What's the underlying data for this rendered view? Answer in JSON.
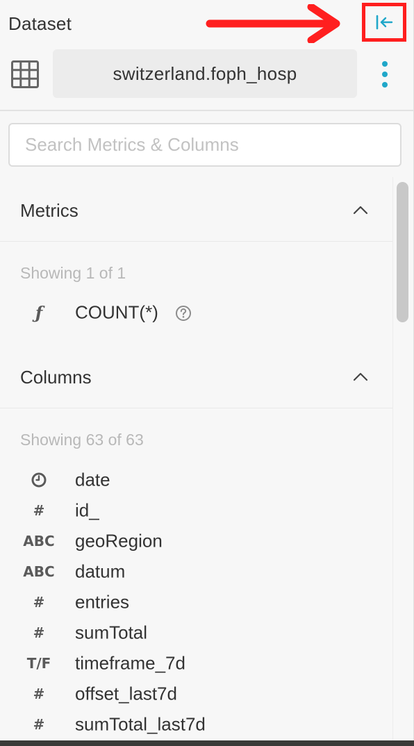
{
  "header": {
    "title": "Dataset",
    "collapse_icon": "collapse-left-arrow-icon"
  },
  "dataset": {
    "icon": "table-grid-icon",
    "name": "switzerland.foph_hosp",
    "more_icon": "more-vertical-icon"
  },
  "search": {
    "placeholder": "Search Metrics & Columns",
    "value": ""
  },
  "metrics": {
    "title": "Metrics",
    "showing": "Showing 1 of 1",
    "items": [
      {
        "type_icon": "ƒ",
        "name": "COUNT(*)",
        "help_icon": "question-circle-icon"
      }
    ]
  },
  "columns": {
    "title": "Columns",
    "showing": "Showing 63 of 63",
    "items": [
      {
        "type_icon": "clock-icon",
        "name": "date"
      },
      {
        "type_icon": "#",
        "name": "id_"
      },
      {
        "type_icon": "ABC",
        "name": "geoRegion"
      },
      {
        "type_icon": "ABC",
        "name": "datum"
      },
      {
        "type_icon": "#",
        "name": "entries"
      },
      {
        "type_icon": "#",
        "name": "sumTotal"
      },
      {
        "type_icon": "T/F",
        "name": "timeframe_7d"
      },
      {
        "type_icon": "#",
        "name": "offset_last7d"
      },
      {
        "type_icon": "#",
        "name": "sumTotal_last7d"
      }
    ]
  },
  "colors": {
    "accent": "#20a7c9",
    "annotation_red": "#ff1f1f",
    "panel_bg": "#f7f7f7",
    "muted_text": "#b8b8b8"
  }
}
